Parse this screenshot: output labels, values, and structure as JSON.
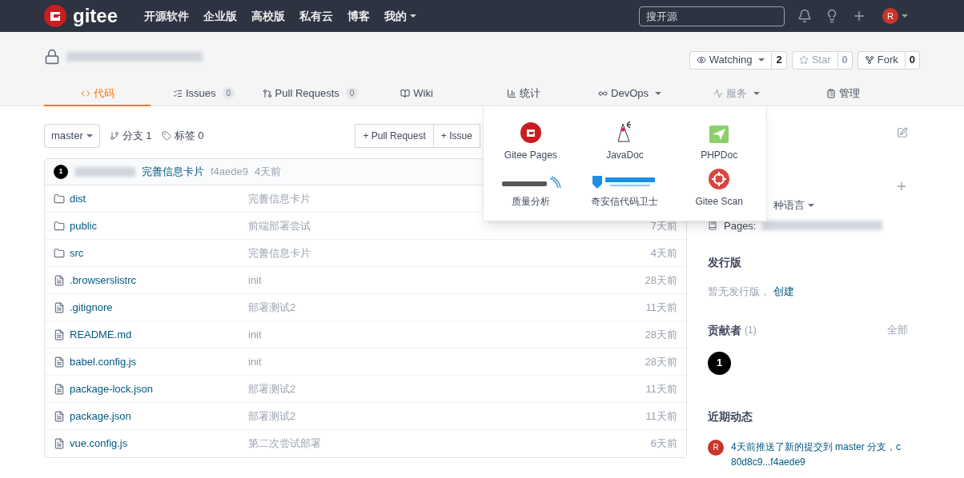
{
  "navbar": {
    "logo": "gitee",
    "links": [
      {
        "label": "开源软件",
        "dropdown": false
      },
      {
        "label": "企业版",
        "dropdown": false
      },
      {
        "label": "高校版",
        "dropdown": false
      },
      {
        "label": "私有云",
        "dropdown": false
      },
      {
        "label": "博客",
        "dropdown": false
      },
      {
        "label": "我的",
        "dropdown": true
      }
    ],
    "search": {
      "placeholder": "搜开源"
    },
    "avatar": "R"
  },
  "repo": {
    "private": true,
    "actions": [
      {
        "label": "Watching",
        "count": "2",
        "dropdown": true,
        "disabled": false
      },
      {
        "label": "Star",
        "count": "0",
        "dropdown": false,
        "disabled": true
      },
      {
        "label": "Fork",
        "count": "0",
        "dropdown": false,
        "disabled": false
      }
    ]
  },
  "tabs": [
    {
      "label": "代码",
      "kind": "code",
      "dropdown": false,
      "selected": true
    },
    {
      "label": "Issues",
      "kind": "issues",
      "badge": "0",
      "dropdown": false,
      "selected": false
    },
    {
      "label": "Pull Requests",
      "kind": "pr",
      "badge": "0",
      "dropdown": false,
      "selected": false
    },
    {
      "label": "Wiki",
      "kind": "wiki",
      "dropdown": false,
      "selected": false
    },
    {
      "label": "统计",
      "kind": "stats",
      "dropdown": false,
      "selected": false
    },
    {
      "label": "DevOps",
      "kind": "devops",
      "dropdown": true,
      "selected": false
    },
    {
      "label": "服务",
      "kind": "service",
      "dropdown": true,
      "selected": false
    },
    {
      "label": "管理",
      "kind": "manage",
      "dropdown": false,
      "selected": false
    }
  ],
  "toolbar": {
    "branch": "master",
    "branches": "分支 1",
    "tags": "标签 0",
    "buttons": [
      "+ Pull Request",
      "+ Issue"
    ]
  },
  "commit": {
    "avatar": "1",
    "message": "完善信息卡片",
    "hash": "f4aede9",
    "time": "4天前"
  },
  "files": [
    {
      "name": "dist",
      "kind": "folder",
      "message": "完善信息卡片"
    },
    {
      "name": "public",
      "kind": "folder",
      "message": "前端部署尝试",
      "time": "7天前"
    },
    {
      "name": "src",
      "kind": "folder",
      "message": "完善信息卡片",
      "time": "4天前"
    },
    {
      "name": ".browserslistrc",
      "kind": "file",
      "message": "init",
      "time": "28天前"
    },
    {
      "name": ".gitignore",
      "kind": "file",
      "message": "部署测试2",
      "time": "11天前"
    },
    {
      "name": "README.md",
      "kind": "file",
      "message": "init",
      "time": "28天前"
    },
    {
      "name": "babel.config.js",
      "kind": "file",
      "message": "init",
      "time": "28天前"
    },
    {
      "name": "package-lock.json",
      "kind": "file",
      "message": "部署测试2",
      "time": "11天前"
    },
    {
      "name": "package.json",
      "kind": "file",
      "message": "部署测试2",
      "time": "11天前"
    },
    {
      "name": "vue.config.js",
      "kind": "file",
      "message": "第二次尝试部署",
      "time": "6天前"
    }
  ],
  "service_menu": [
    {
      "label": "Gitee Pages",
      "kind": "gitee"
    },
    {
      "label": "JavaDoc",
      "kind": "java"
    },
    {
      "label": "PHPDoc",
      "kind": "php"
    },
    {
      "label": "质量分析",
      "kind": "sonar"
    },
    {
      "label": "奇安信代码卫士",
      "kind": "qianxin"
    },
    {
      "label": "Gitee Scan",
      "kind": "scan"
    }
  ],
  "sidebar": {
    "language": "种语言",
    "pages_label": "Pages:",
    "releases_title": "发行版",
    "releases_empty": "暂无发行版，",
    "releases_create": "创建",
    "contributors_title": "贡献者",
    "contributors_count": "(1)",
    "contributors_all": "全部",
    "contributors": [
      "1"
    ],
    "activity_title": "近期动态",
    "activity": [
      {
        "avatar": "R",
        "text": "4天前推送了新的提交到 master 分支，c",
        "link": "80d8c9...f4aede9"
      }
    ]
  }
}
